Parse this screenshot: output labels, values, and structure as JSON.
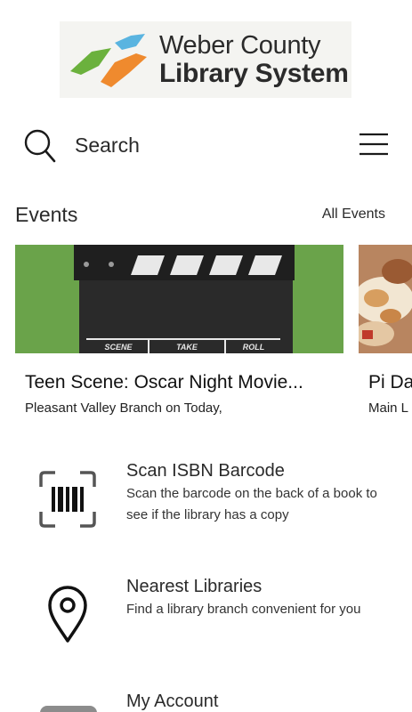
{
  "header": {
    "logo": {
      "line1": "Weber County",
      "line2": "Library System",
      "colors": {
        "green": "#6bb13d",
        "blue": "#5ab4e0",
        "orange": "#ef8a2e"
      }
    }
  },
  "search": {
    "label": "Search",
    "icon": "search-icon",
    "menu_icon": "hamburger-menu-icon"
  },
  "events": {
    "title": "Events",
    "all_link": "All Events",
    "cards": [
      {
        "title": "Teen Scene: Oscar Night Movie...",
        "subtitle": "Pleasant Valley Branch on Today,",
        "image": "clapperboard-image",
        "clapper_labels": [
          "SCENE",
          "TAKE",
          "ROLL"
        ]
      },
      {
        "title": "Pi Da",
        "subtitle": "Main L",
        "image": "pastry-food-image"
      }
    ]
  },
  "features": [
    {
      "title": "Scan ISBN Barcode",
      "description": "Scan the barcode on the back of a book to see if the library has a copy",
      "icon": "barcode-scan-icon"
    },
    {
      "title": "Nearest Libraries",
      "description": "Find a library branch convenient for you",
      "icon": "map-pin-icon"
    },
    {
      "title": "My Account",
      "icon": "library-card-icon"
    }
  ]
}
